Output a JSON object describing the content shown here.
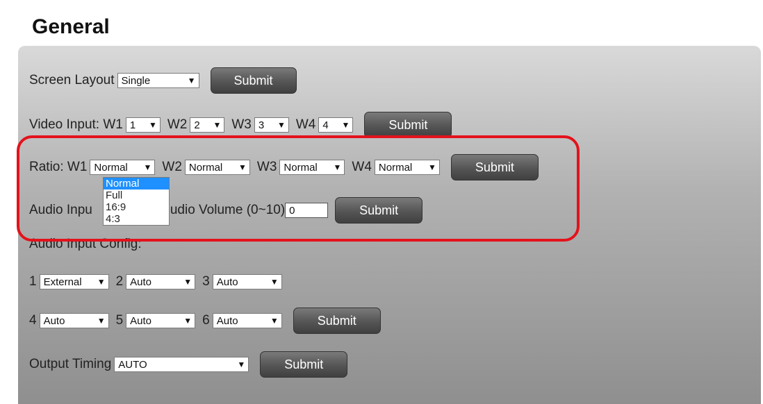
{
  "page": {
    "title": "General"
  },
  "screen_layout": {
    "label": "Screen Layout",
    "value": "Single",
    "submit": "Submit"
  },
  "video_input": {
    "label": "Video Input: W1",
    "w1": "1",
    "w2_label": "W2",
    "w2": "2",
    "w3_label": "W3",
    "w3": "3",
    "w4_label": "W4",
    "w4": "4",
    "submit": "Submit"
  },
  "ratio": {
    "label": "Ratio: W1",
    "w1": "Normal",
    "w2_label": "W2",
    "w2": "Normal",
    "w3_label": "W3",
    "w3": "Normal",
    "w4_label": "W4",
    "w4": "Normal",
    "submit": "Submit",
    "dropdown_options": [
      "Normal",
      "Full",
      "16:9",
      "4:3"
    ]
  },
  "audio": {
    "label_visible_left": "Audio Inpu",
    "label_visible_right": "udio Volume (0~10)",
    "volume_value": "0",
    "submit": "Submit"
  },
  "audio_input_config": {
    "label": "Audio Input Config:",
    "row1": [
      {
        "num": "1",
        "value": "External"
      },
      {
        "num": "2",
        "value": "Auto"
      },
      {
        "num": "3",
        "value": "Auto"
      }
    ],
    "row2": [
      {
        "num": "4",
        "value": "Auto"
      },
      {
        "num": "5",
        "value": "Auto"
      },
      {
        "num": "6",
        "value": "Auto"
      }
    ],
    "submit": "Submit"
  },
  "output_timing": {
    "label": "Output Timing",
    "value": "AUTO",
    "submit": "Submit"
  },
  "icons": {
    "select_arrow": "triangle-down-icon"
  },
  "colors": {
    "highlight": "#e3121b",
    "selected_option": "#1e90ff"
  }
}
